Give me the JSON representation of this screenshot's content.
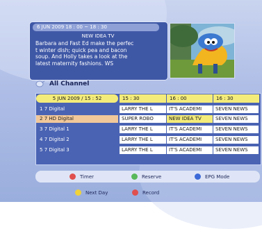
{
  "info": {
    "time": "6 JUN 2009  18 : 00 ~ 18 : 30",
    "title": "NEW IDEA TV",
    "desc_lines": [
      "Barbara and Fast Ed make the perfec",
      "t winter dish; quick pea and bacon",
      "soup. And Holly takes a look at the",
      "latest maternity fashions. WS"
    ]
  },
  "channel_group": "All Channel",
  "schedule": {
    "datetime": "5 JUN 2009 / 15 : 52",
    "times": [
      "15 : 30",
      "16 : 00",
      "16 : 30"
    ],
    "rows": [
      {
        "num": "1",
        "name": "7 Digital",
        "cells": [
          "LARRY THE L",
          "IT'S ACADEMI",
          "SEVEN NEWS"
        ]
      },
      {
        "num": "2",
        "name": "7 HD Digital",
        "cells": [
          "SUPER ROBO",
          "NEW IDEA TV",
          "SEVEN NEWS"
        ]
      },
      {
        "num": "3",
        "name": "7 Digital 1",
        "cells": [
          "LARRY THE L",
          "IT'S ACADEMI",
          "SEVEN NEWS"
        ]
      },
      {
        "num": "4",
        "name": "7 Digital 2",
        "cells": [
          "LARRY THE L",
          "IT'S ACADEMI",
          "SEVEN NEWS"
        ]
      },
      {
        "num": "5",
        "name": "7 Digital 3",
        "cells": [
          "LARRY THE L",
          "IT'S ACADEMI",
          "SEVEN NEWS"
        ]
      }
    ]
  },
  "footer": {
    "timer": "Timer",
    "reserve": "Reserve",
    "epg_mode": "EPG Mode",
    "next_day": "Next Day",
    "record": "Record"
  },
  "colors": {
    "red": "#e0504e",
    "green": "#58b85a",
    "yellow": "#f0d23a",
    "blue": "#3d6ad8"
  }
}
